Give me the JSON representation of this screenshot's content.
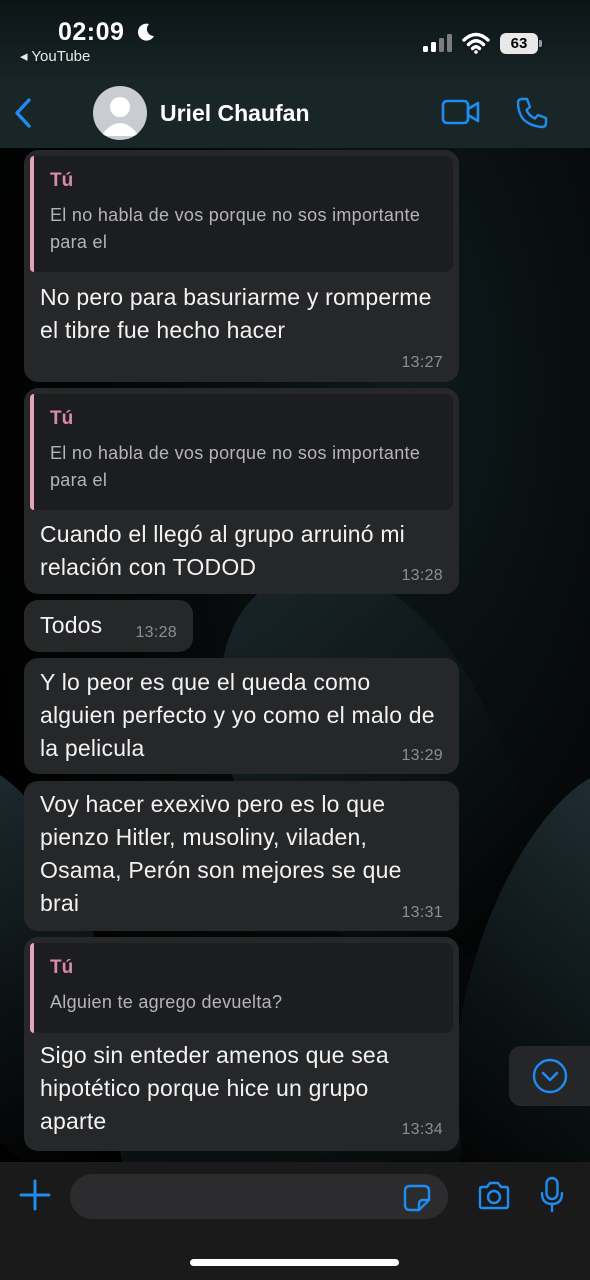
{
  "status_bar": {
    "time": "02:09",
    "back_app": "◂ YouTube",
    "battery": "63"
  },
  "header": {
    "contact_name": "Uriel Chaufan"
  },
  "messages": [
    {
      "quote": {
        "author": "Tú",
        "text": "El no habla de vos porque no sos importante para el"
      },
      "text": "No pero para basuriarme y romperme el tibre fue hecho hacer",
      "time": "13:27"
    },
    {
      "quote": {
        "author": "Tú",
        "text": "El no habla de vos porque no sos importante para el"
      },
      "text": "Cuando el llegó al grupo arruinó mi relación con TODOD",
      "time": "13:28"
    },
    {
      "text": "Todos",
      "time": "13:28"
    },
    {
      "text": "Y lo peor es que el queda como alguien perfecto y yo como el malo de la pelicula",
      "time": "13:29"
    },
    {
      "text": "Voy hacer exexivo pero es lo que pienzo Hitler, musoliny, viladen, Osama, Perón son mejores se que brai",
      "time": "13:31"
    },
    {
      "quote": {
        "author": "Tú",
        "text": "Alguien te agrego devuelta?"
      },
      "text": "Sigo sin enteder amenos que sea hipotético porque hice un grupo aparte",
      "time": "13:34"
    }
  ],
  "composer": {
    "value": "",
    "placeholder": ""
  },
  "colors": {
    "accent": "#1e8cf0",
    "bubble": "#262729",
    "quote_bar": "#e6a0bb",
    "quote_author": "#d78ba8"
  },
  "icons": {
    "back": "chevron-left-icon",
    "video": "video-camera-icon",
    "phone": "phone-icon",
    "plus": "plus-icon",
    "sticker": "sticker-icon",
    "camera": "camera-icon",
    "mic": "microphone-icon",
    "scroll": "chevron-down-circle-icon"
  }
}
